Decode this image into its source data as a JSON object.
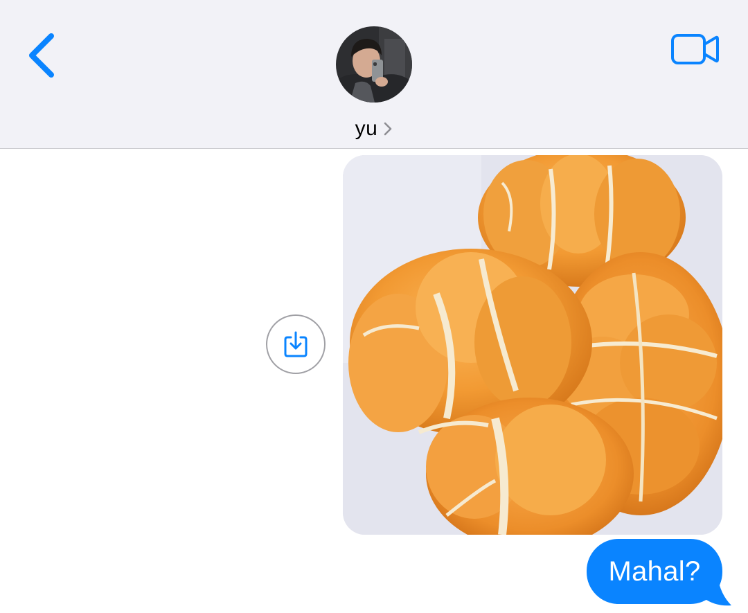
{
  "colors": {
    "accent": "#0a84ff",
    "header_bg": "#f2f2f7",
    "outgoing_bubble": "#0a84ff"
  },
  "header": {
    "back_icon": "chevron-left-icon",
    "video_icon": "video-camera-icon",
    "contact_name": "yu",
    "name_chevron_icon": "chevron-right-icon"
  },
  "messages": [
    {
      "type": "image",
      "direction": "outgoing",
      "content": "peeled-mandarin-oranges-photo",
      "action_icon": "save-to-photos-icon"
    },
    {
      "type": "text",
      "direction": "outgoing",
      "text": "Mahal?"
    }
  ]
}
